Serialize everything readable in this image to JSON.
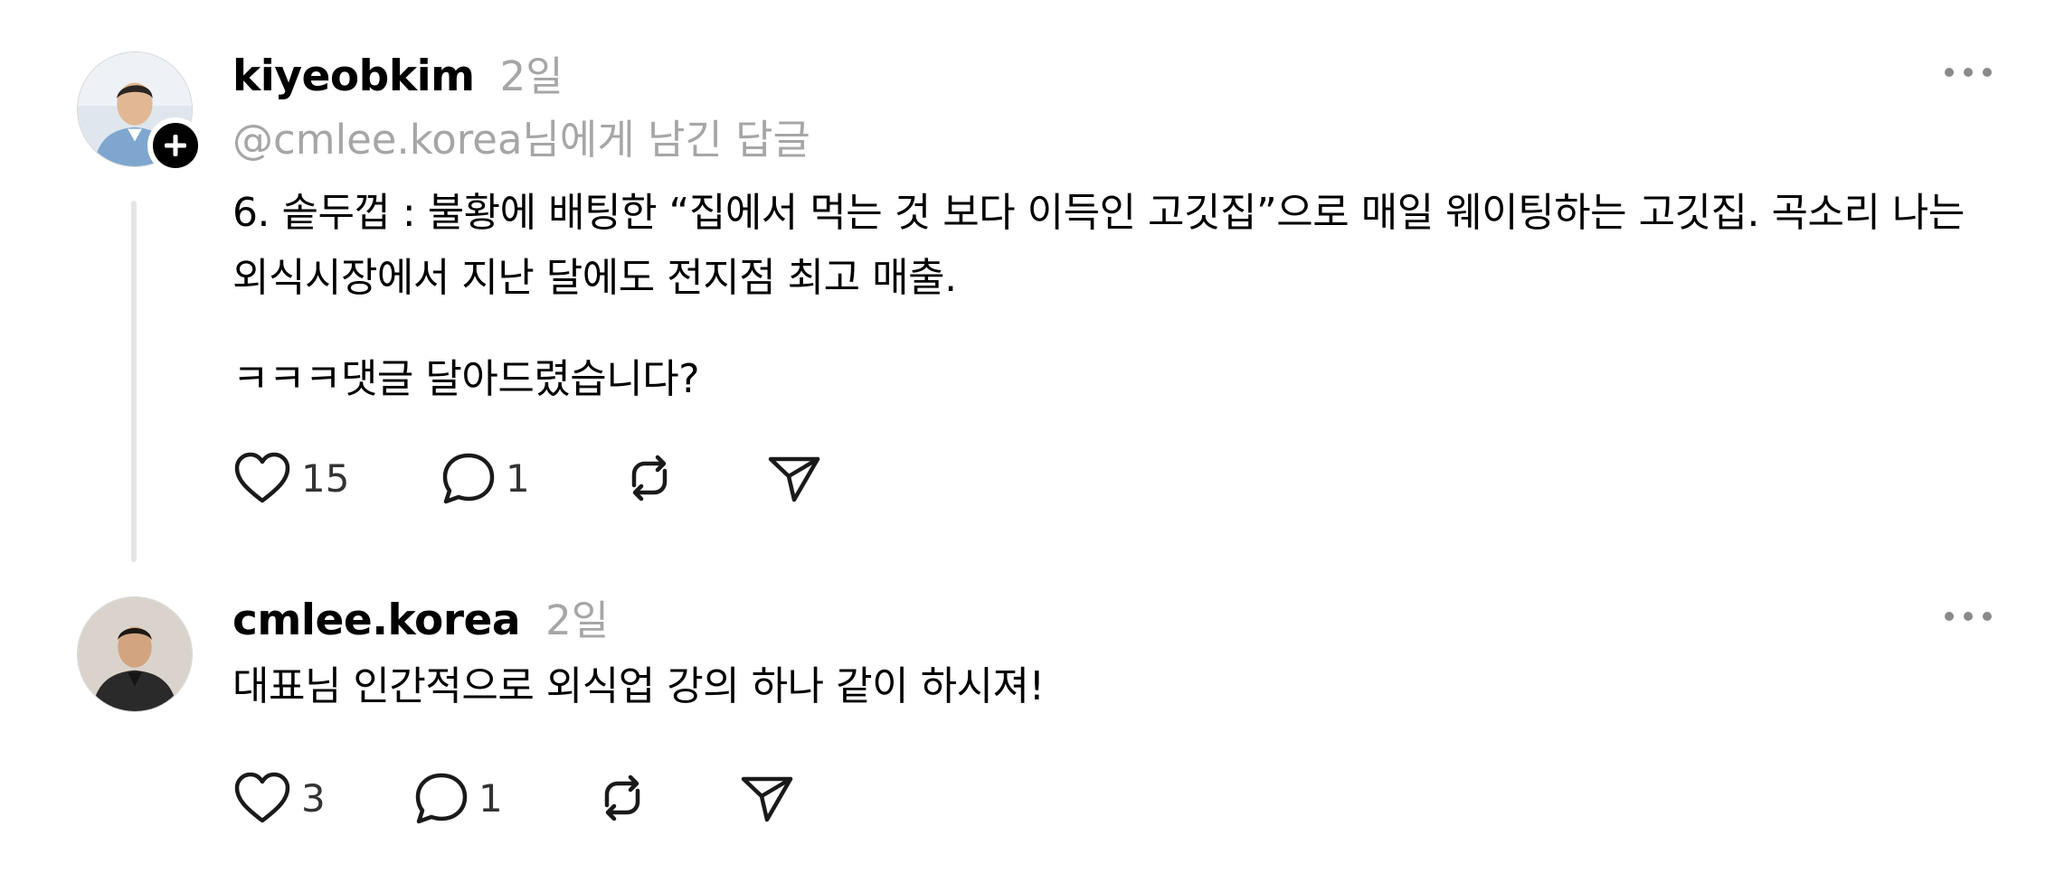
{
  "posts": [
    {
      "username": "kiyeobkim",
      "time": "2일",
      "reply_to": "@cmlee.korea님에게 남긴 답글",
      "paragraphs": [
        "6. 솥두껍 : 불황에 배팅한 “집에서 먹는 것 보다 이득인 고깃집”으로 매일 웨이팅하는 고깃집. 곡소리 나는 외식시장에서 지난 달에도 전지점 최고 매출.",
        "ㅋㅋㅋ댓글 달아드렸습니다?"
      ],
      "likes": "15",
      "replies": "1",
      "icons": [
        "heart-icon",
        "comment-icon",
        "repost-icon",
        "share-icon",
        "plus-icon",
        "more-icon"
      ]
    },
    {
      "username": "cmlee.korea",
      "time": "2일",
      "paragraphs": [
        "대표님 인간적으로 외식업 강의 하나 같이 하시져!"
      ],
      "likes": "3",
      "replies": "1",
      "icons": [
        "heart-icon",
        "comment-icon",
        "repost-icon",
        "share-icon",
        "more-icon"
      ]
    }
  ],
  "colors": {
    "text": "#000000",
    "muted": "#a6a6a6",
    "thread_line": "#e5e5e5",
    "badge": "#000000"
  }
}
